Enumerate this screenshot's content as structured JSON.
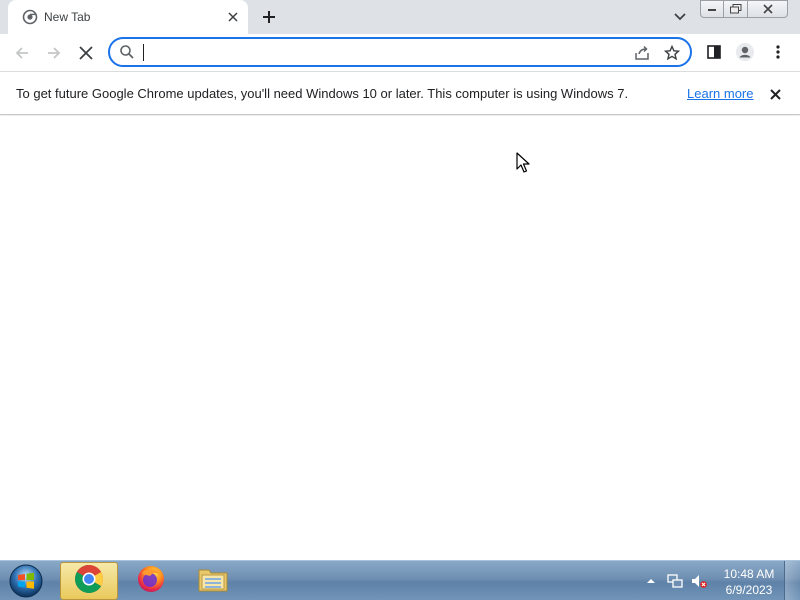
{
  "browser": {
    "tab": {
      "title": "New Tab",
      "favicon": "chrome-loading-favicon-icon"
    },
    "window_controls": [
      "minimize",
      "maximize",
      "close"
    ],
    "omnibox": {
      "value": "",
      "placeholder": ""
    },
    "accent_color": "#1a73e8"
  },
  "infobar": {
    "message": "To get future Google Chrome updates, you'll need Windows 10 or later. This computer is using Windows 7.",
    "link_label": "Learn more"
  },
  "taskbar": {
    "items": [
      "chrome-icon",
      "firefox-icon",
      "file-explorer-icon"
    ],
    "clock": {
      "time": "10:48 AM",
      "date": "6/9/2023"
    }
  }
}
